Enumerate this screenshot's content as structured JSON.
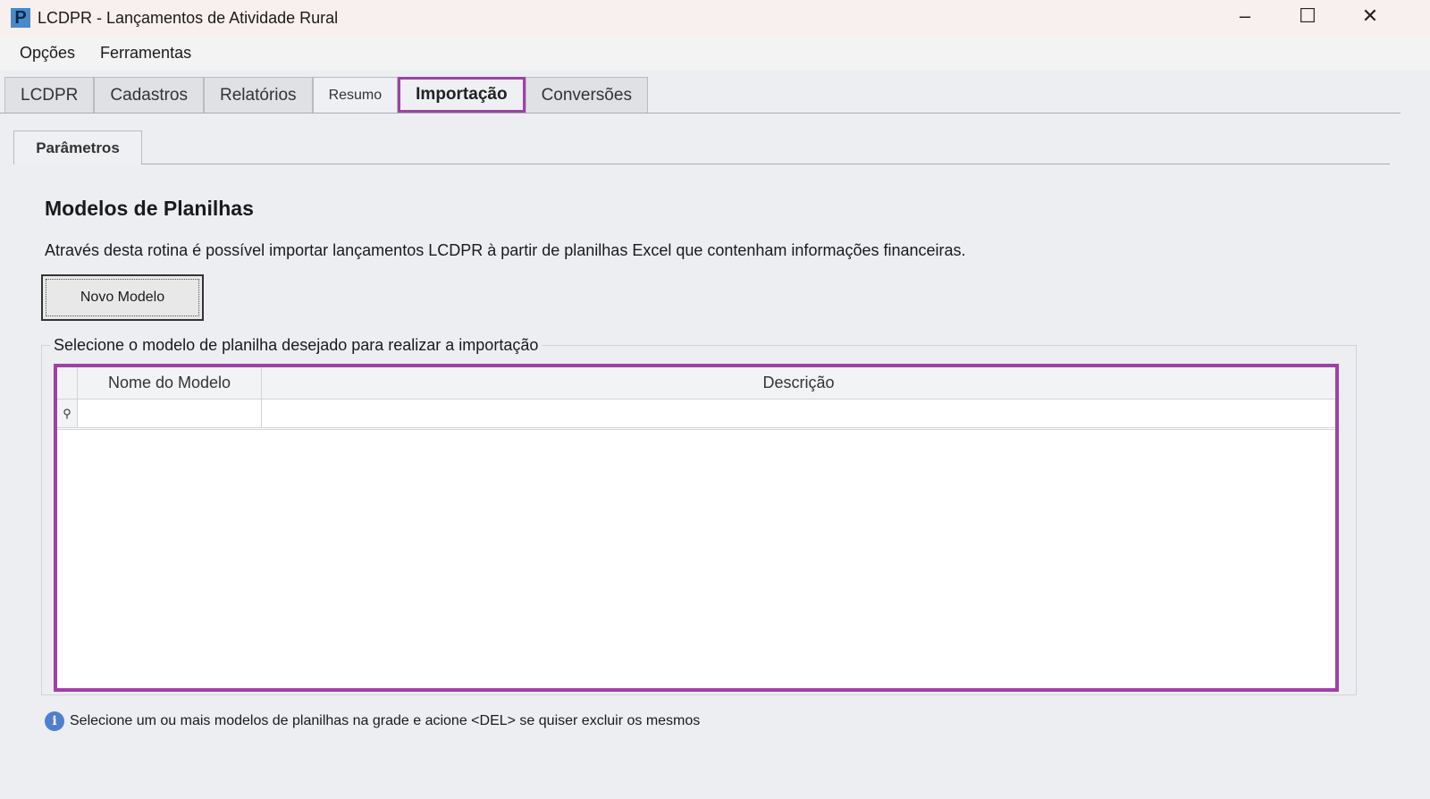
{
  "window": {
    "title": "LCDPR - Lançamentos de Atividade Rural",
    "icon_letter": "P",
    "minimize": "–",
    "maximize": "☐",
    "close": "✕"
  },
  "menu": [
    "Opções",
    "Ferramentas"
  ],
  "tabs": [
    "LCDPR",
    "Cadastros",
    "Relatórios",
    "Resumo",
    "Importação",
    "Conversões"
  ],
  "subtab": "Parâmetros",
  "heading": "Modelos de Planilhas",
  "description": "Através desta rotina é possível importar lançamentos LCDPR  à partir de planilhas Excel que contenham informações financeiras.",
  "new_model_button": "Novo Modelo",
  "group_label": "Selecione o modelo de planilha desejado para realizar a importação",
  "grid": {
    "columns": [
      "Nome do Modelo",
      "Descrição"
    ],
    "filter_icon": "⚲"
  },
  "footer": {
    "icon": "i",
    "text": "Selecione um ou mais modelos de planilhas na grade e acione <DEL> se quiser excluir os mesmos"
  }
}
